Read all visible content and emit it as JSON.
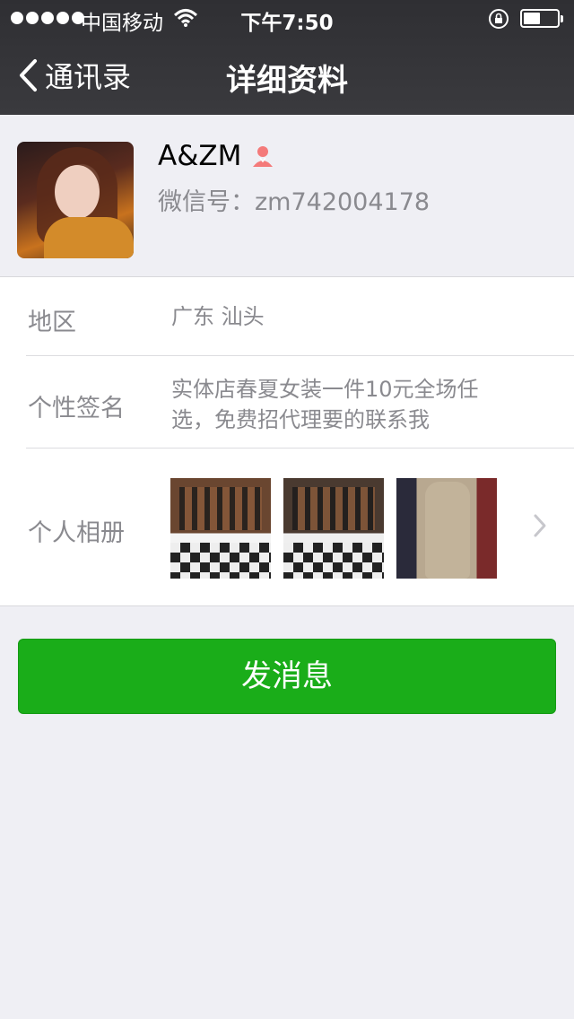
{
  "status_bar": {
    "carrier": "中国移动",
    "time": "下午7:50",
    "signal_bars": 5,
    "battery_level": 0.5
  },
  "nav": {
    "back_label": "通讯录",
    "title": "详细资料"
  },
  "profile": {
    "name": "A&ZM",
    "wechat_id": "微信号：zm742004178",
    "gender_icon": "female-user-icon"
  },
  "info": {
    "region": {
      "label": "地区",
      "value": "广东 汕头"
    },
    "signature": {
      "label": "个性签名",
      "value": "实体店春夏女装一件10元全场任选，免费招代理要的联系我"
    },
    "album": {
      "label": "个人相册"
    }
  },
  "actions": {
    "send_message": "发消息"
  },
  "colors": {
    "header_bg": "#35353a",
    "page_bg": "#efeff4",
    "primary_green": "#1aad19",
    "secondary_text": "#8a8a8f"
  }
}
